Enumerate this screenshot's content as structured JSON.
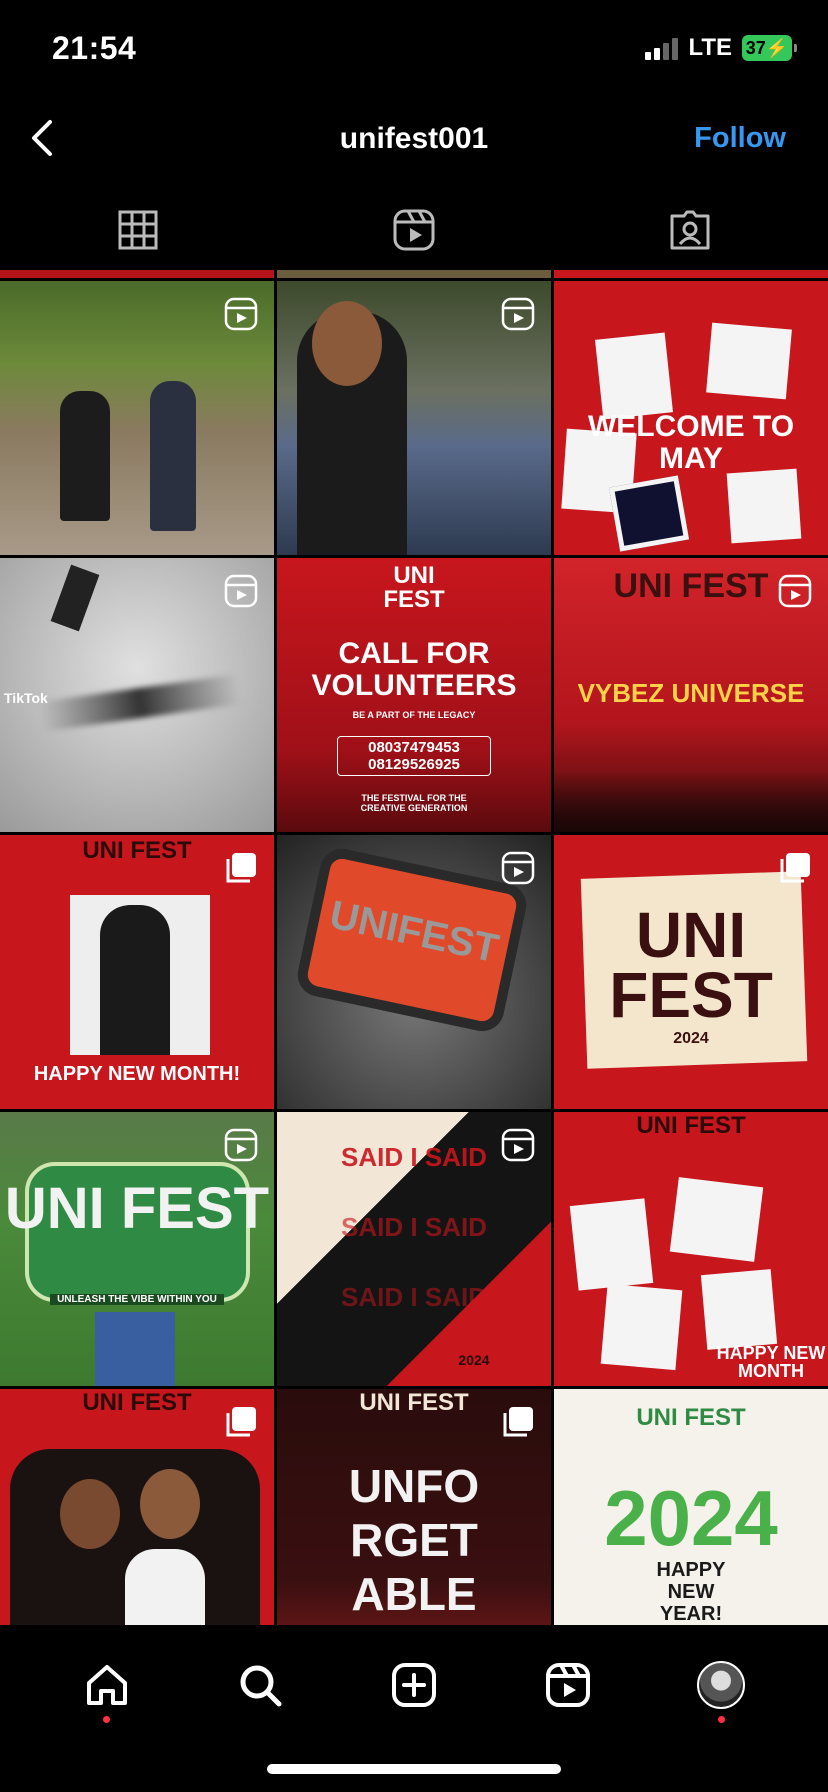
{
  "status_bar": {
    "time": "21:54",
    "network": "LTE",
    "battery": "37"
  },
  "header": {
    "username": "unifest001",
    "follow_label": "Follow",
    "back_icon": "chevron-left-icon"
  },
  "tabs": [
    {
      "icon": "grid-icon"
    },
    {
      "icon": "reels-icon"
    },
    {
      "icon": "tagged-icon"
    }
  ],
  "colors": {
    "follow": "#3897f0",
    "brand_red": "#c8161d",
    "notification_dot": "#ff3040"
  },
  "posts": [
    {
      "type": "reel",
      "text": ""
    },
    {
      "type": "reel",
      "text": ""
    },
    {
      "type": "image",
      "text": "WELCOME TO MAY"
    },
    {
      "type": "reel",
      "text": "TikTok"
    },
    {
      "type": "image",
      "text": "CALL FOR VOLUNTEERS",
      "sub": "BE A PART OF THE LEGACY",
      "phones": "08037479453 08129526925",
      "footer": "THE FESTIVAL FOR THE CREATIVE GENERATION"
    },
    {
      "type": "reel",
      "text": "VYBEZ UNIVERSE",
      "brand": "UNI FEST"
    },
    {
      "type": "carousel",
      "text": "HAPPY NEW MONTH!",
      "brand": "UNI FEST"
    },
    {
      "type": "reel",
      "text": "UNIFEST"
    },
    {
      "type": "carousel",
      "text": "UNI FEST",
      "sub": "2024"
    },
    {
      "type": "reel",
      "text": "UNI FEST",
      "sub": "UNLEASH THE VIBE WITHIN YOU"
    },
    {
      "type": "reel",
      "text": "SAID I SAID",
      "sub": "2024"
    },
    {
      "type": "image",
      "text": "HAPPY NEW MONTH",
      "brand": "UNI FEST"
    },
    {
      "type": "carousel",
      "text": "UNI FEST"
    },
    {
      "type": "carousel",
      "text": "UNFO RGET ABLE",
      "brand": "UNI FEST"
    },
    {
      "type": "image",
      "text": "2024",
      "sub": "HAPPY NEW YEAR!",
      "brand": "UNI FEST"
    }
  ],
  "bottom_nav": [
    {
      "icon": "home-icon",
      "active": true
    },
    {
      "icon": "search-icon"
    },
    {
      "icon": "create-icon"
    },
    {
      "icon": "reels-icon"
    },
    {
      "icon": "profile-avatar",
      "active": true
    }
  ]
}
